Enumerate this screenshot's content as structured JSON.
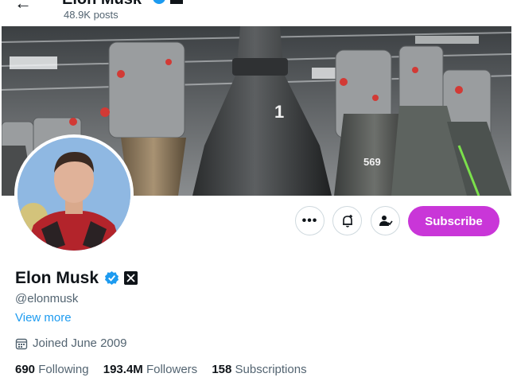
{
  "header": {
    "title": "Elon Musk",
    "posts_count": "48.9K posts"
  },
  "banner": {
    "engine_label_1": "1",
    "engine_label_2": "569"
  },
  "actions": {
    "more_glyph": "•••",
    "subscribe_label": "Subscribe"
  },
  "profile": {
    "name": "Elon Musk",
    "handle": "@elonmusk",
    "view_more": "View more",
    "joined": "Joined June 2009"
  },
  "stats": {
    "following_count": "690",
    "following_label": "Following",
    "followers_count": "193.4M",
    "followers_label": "Followers",
    "subscriptions_count": "158",
    "subscriptions_label": "Subscriptions"
  },
  "colors": {
    "accent": "#1d9bf0",
    "subscribe": "#c936d8"
  },
  "icons": [
    "back-arrow-icon",
    "verified-badge-icon",
    "x-logo-icon",
    "more-icon",
    "notification-bell-icon",
    "following-person-icon",
    "calendar-icon"
  ]
}
